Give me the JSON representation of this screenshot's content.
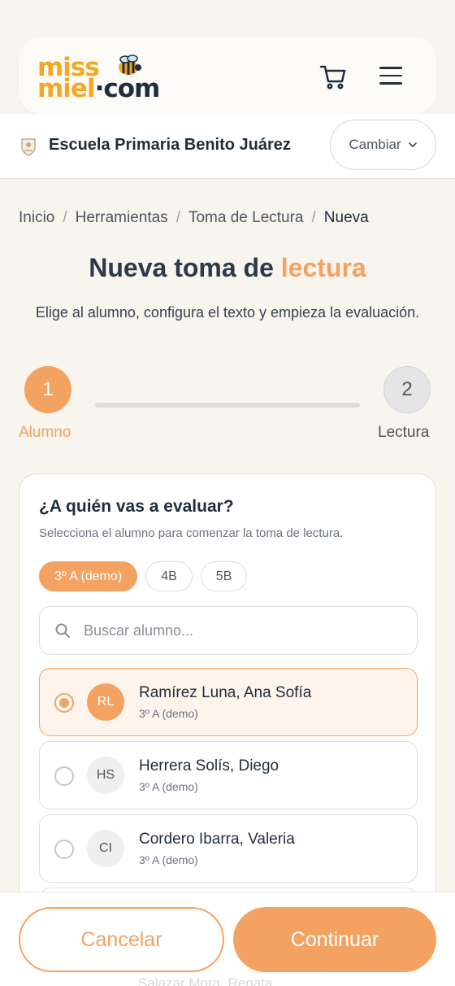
{
  "header": {
    "logo_line1": "miss",
    "logo_line2_a": "miel",
    "logo_line2_dot": "·",
    "logo_line2_b": "com",
    "cart_icon": "cart-icon",
    "menu_icon": "hamburger-menu-icon"
  },
  "school": {
    "icon": "school-crest-icon",
    "name": "Escuela Primaria Benito Juárez",
    "change_label": "Cambiar"
  },
  "breadcrumb": {
    "items": [
      "Inicio",
      "Herramientas",
      "Toma de Lectura",
      "Nueva"
    ],
    "separator": "/"
  },
  "page": {
    "title_main": "Nueva toma de",
    "title_accent": "lectura",
    "subtitle": "Elige al alumno, configura el texto y empieza la evaluación."
  },
  "stepper": {
    "steps": [
      {
        "number": "1",
        "label": "Alumno",
        "active": true
      },
      {
        "number": "2",
        "label": "Lectura",
        "active": false
      }
    ]
  },
  "card": {
    "title": "¿A quién vas a evaluar?",
    "subtitle": "Selecciona el alumno para comenzar la toma de lectura.",
    "groups": [
      {
        "label": "3º A (demo)",
        "active": true
      },
      {
        "label": "4B",
        "active": false
      },
      {
        "label": "5B",
        "active": false
      }
    ],
    "search_placeholder": "Buscar alumno...",
    "search_value": "",
    "students": [
      {
        "initials": "RL",
        "name": "Ramírez Luna, Ana Sofía",
        "group": "3º A (demo)",
        "selected": true
      },
      {
        "initials": "HS",
        "name": "Herrera Solís, Diego",
        "group": "3º A (demo)",
        "selected": false
      },
      {
        "initials": "CI",
        "name": "Cordero Ibarra, Valeria",
        "group": "3º A (demo)",
        "selected": false
      }
    ],
    "peek_text": "Salazar Mora, Renata"
  },
  "actions": {
    "cancel_label": "Cancelar",
    "continue_label": "Continuar"
  },
  "colors": {
    "accent": "#f4a261",
    "logo_yellow": "#f6a623",
    "text_dark": "#1f2d3d",
    "background": "#f8f4ee"
  }
}
